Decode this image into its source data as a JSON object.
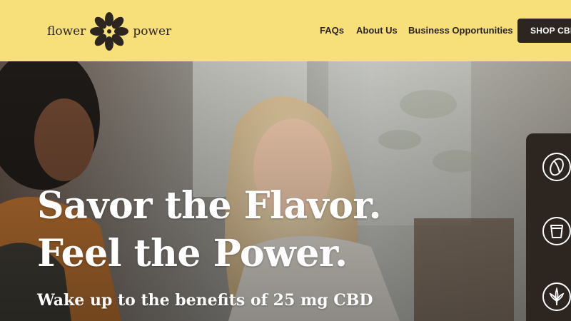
{
  "header": {
    "logo": {
      "word_left": "flower",
      "word_right": "power",
      "icon": "flower-icon"
    },
    "nav": [
      {
        "label": "FAQs"
      },
      {
        "label": "About Us"
      },
      {
        "label": "Business Opportunities"
      }
    ],
    "cta": {
      "label": "SHOP CBD"
    }
  },
  "hero": {
    "headline_line1": "Savor the Flavor.",
    "headline_line2": "Feel the Power.",
    "subhead": "Wake up to the benefits of 25 mg CBD"
  },
  "side_panel": {
    "icons": [
      "coffee-bean-icon",
      "cup-icon",
      "cannabis-leaf-icon"
    ]
  },
  "colors": {
    "header_bg": "#f7df7a",
    "dark": "#2d2520",
    "hero_text": "#ffffff"
  }
}
